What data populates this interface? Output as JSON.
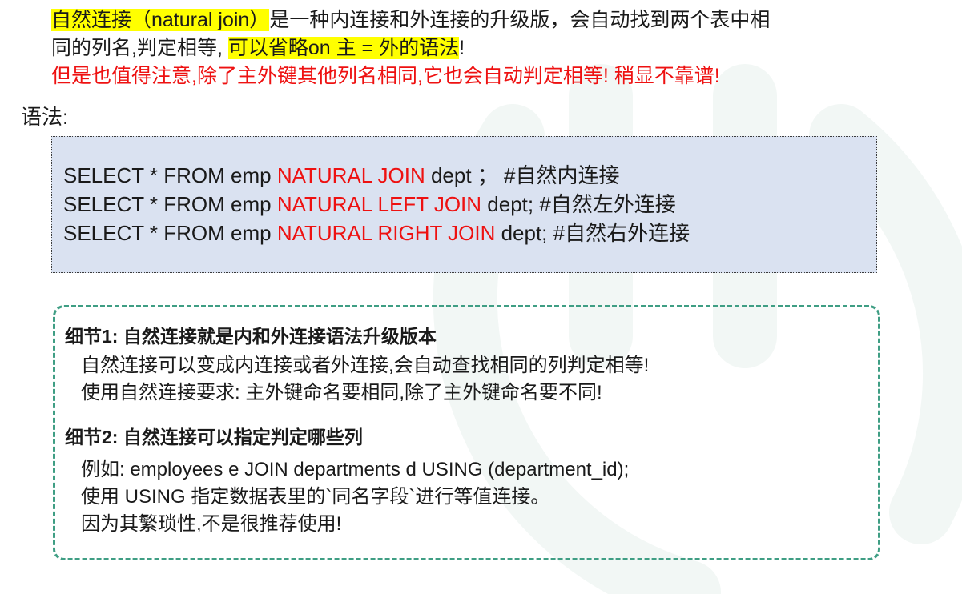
{
  "intro": {
    "line1": {
      "highlight1": "自然连接（natural join）",
      "rest": "是一种内连接和外连接的升级版，会自动找到两个表中相"
    },
    "line2": {
      "before": "同的列名,判定相等,",
      "highlight2": "可以省略on 主 = 外的语法",
      "after": "!"
    },
    "line3_warning": "但是也值得注意,除了主外键其他列名相同,它也会自动判定相等! 稍显不靠谱!"
  },
  "syntax_label": "语法:",
  "code": [
    {
      "prefix": "SELECT * FROM emp ",
      "keyword": "NATURAL JOIN",
      "suffix": " dept ； #自然内连接"
    },
    {
      "prefix": "SELECT * FROM emp ",
      "keyword": "NATURAL LEFT JOIN",
      "suffix": " dept; #自然左外连接"
    },
    {
      "prefix": "SELECT * FROM emp ",
      "keyword": "NATURAL RIGHT JOIN",
      "suffix": " dept; #自然右外连接"
    }
  ],
  "details": {
    "detail1": {
      "title": "细节1:  自然连接就是内和外连接语法升级版本",
      "lines": [
        "自然连接可以变成内连接或者外连接,会自动查找相同的列判定相等!",
        "使用自然连接要求: 主外键命名要相同,除了主外键命名要不同!"
      ]
    },
    "detail2": {
      "title": "细节2: 自然连接可以指定判定哪些列",
      "lines": [
        "例如: employees e JOIN departments d USING (department_id);",
        "使用 USING 指定数据表里的`同名字段`进行等值连接。",
        "因为其繁琐性,不是很推荐使用!"
      ]
    }
  },
  "colors": {
    "highlight": "#ffff00",
    "warning_red": "#ee1111",
    "code_bg": "#dae2f1",
    "dashed_border": "#3f9e84"
  }
}
